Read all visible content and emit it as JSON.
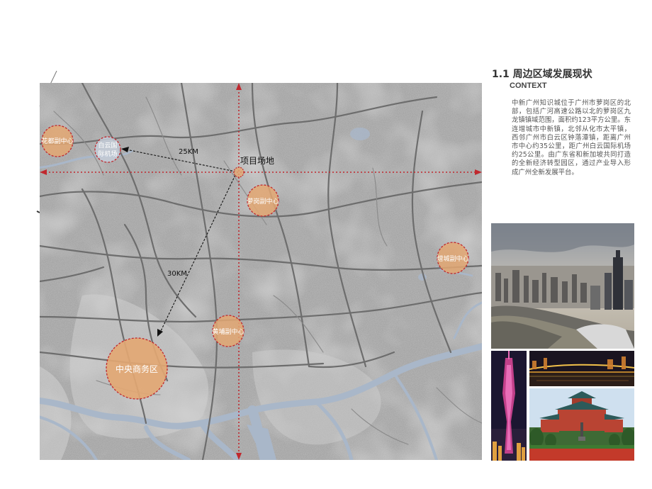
{
  "header": {
    "title": "1.1 周边区域发展现状",
    "subtitle": "CONTEXT"
  },
  "description": "中新广州知识城位于广州市萝岗区的北部，包括广河高速公路以北的萝岗区九龙镇镇域范围，面积约123平方公里。东连增城市中新镇，北邻从化市太平镇，西邻广州市白云区钟落潭镇，距离广州市中心约35公里，距广州白云国际机场约25公里。由广东省和新加坡共同打造的全新经济转型园区，通过产业导入形成广州全新发展平台。",
  "map": {
    "project_site_label": "项目场地",
    "distance_airport_label": "25KM",
    "distance_cbd_label": "30KM",
    "districts": [
      {
        "id": "huadu",
        "label": "花都副中心"
      },
      {
        "id": "airport",
        "label_line1": "白云国",
        "label_line2": "际机场"
      },
      {
        "id": "luogang",
        "label": "萝岗副中心"
      },
      {
        "id": "zengcheng",
        "label": "增城副中心"
      },
      {
        "id": "huangpu",
        "label": "黄埔副中心"
      },
      {
        "id": "cbd",
        "label": "中央商务区"
      }
    ],
    "colors": {
      "circle_fill": "#e3a772",
      "circle_stroke": "#c0282e",
      "axis": "#c0282e",
      "water": "#a9b7c9"
    }
  },
  "photos": [
    {
      "name": "city-skyline-photo"
    },
    {
      "name": "canton-tower-photo"
    },
    {
      "name": "river-bridge-night-photo"
    },
    {
      "name": "sun-yat-sen-memorial-hall-photo"
    }
  ]
}
